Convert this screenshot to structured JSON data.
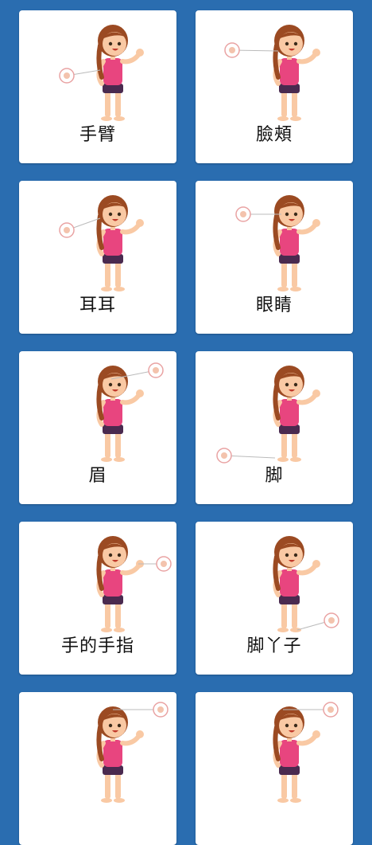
{
  "cards": [
    {
      "label": "手臂",
      "callout": "arm"
    },
    {
      "label": "臉頰",
      "callout": "cheek"
    },
    {
      "label": "耳耳",
      "callout": "ear"
    },
    {
      "label": "眼睛",
      "callout": "eye"
    },
    {
      "label": "眉",
      "callout": "eyebrow"
    },
    {
      "label": "脚",
      "callout": "foot"
    },
    {
      "label": "手的手指",
      "callout": "finger"
    },
    {
      "label": "脚丫子",
      "callout": "toe"
    },
    {
      "label": "",
      "callout": "mouth"
    },
    {
      "label": "",
      "callout": "hair"
    }
  ],
  "colors": {
    "background": "#2a6db0",
    "card": "#ffffff",
    "shirt": "#e8457f",
    "shorts": "#4a2a4f",
    "hair": "#9b4a22",
    "skin": "#f9c9a4",
    "callout_ring": "#e9a3a3"
  }
}
